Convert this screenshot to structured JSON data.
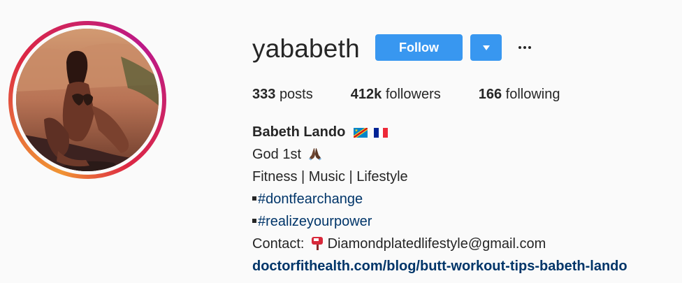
{
  "profile": {
    "username": "yababeth",
    "follow_label": "Follow",
    "stats": {
      "posts_count": "333",
      "posts_label": "posts",
      "followers_count": "412k",
      "followers_label": "followers",
      "following_count": "166",
      "following_label": "following"
    },
    "bio": {
      "full_name": "Babeth Lando",
      "flags": [
        "flag-dr-congo-icon",
        "flag-france-icon"
      ],
      "line1": "God 1st",
      "line1_icon": "praying-hands-icon",
      "line2": "Fitness | Music | Lifestyle",
      "hashtag1": "#dontfearchange",
      "hashtag2": "#realizeyourpower",
      "contact_label": "Contact:",
      "contact_icon": "mailbox-icon",
      "contact_email": "Diamondplatedlifestyle@gmail.com",
      "website": "doctorfithealth.com/blog/butt-workout-tips-babeth-lando"
    }
  },
  "colors": {
    "follow_button": "#3897f0",
    "link": "#003569",
    "text": "#262626",
    "background": "#fafafa"
  }
}
